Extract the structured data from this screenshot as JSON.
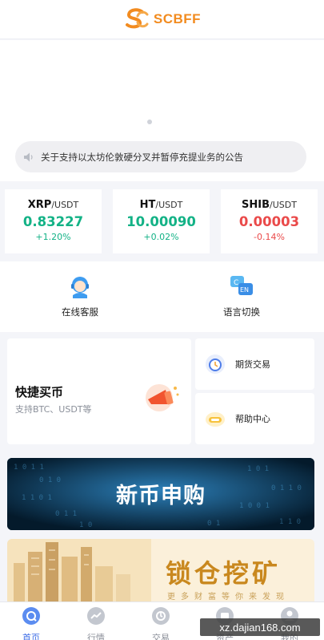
{
  "header": {
    "brand": "SCBFF",
    "brand_color": "#f28b1f"
  },
  "notice": {
    "icon": "speaker-icon",
    "text": "关于支持以太坊伦敦硬分叉并暂停充提业务的公告"
  },
  "tickers": [
    {
      "symbol": "XRP",
      "quote": "/USDT",
      "price": "0.83227",
      "change": "+1.20%",
      "direction": "up"
    },
    {
      "symbol": "HT",
      "quote": "/USDT",
      "price": "10.00090",
      "change": "+0.02%",
      "direction": "up"
    },
    {
      "symbol": "SHIB",
      "quote": "/USDT",
      "price": "0.00003",
      "change": "-0.14%",
      "direction": "down"
    }
  ],
  "services": [
    {
      "label": "在线客服",
      "icon": "customer-service-icon"
    },
    {
      "label": "语言切换",
      "icon": "language-switch-icon"
    }
  ],
  "quick_buy": {
    "title": "快捷买币",
    "subtitle": "支持BTC、USDT等",
    "icon": "megaphone-icon"
  },
  "side_cards": [
    {
      "label": "期货交易",
      "icon": "futures-icon"
    },
    {
      "label": "帮助中心",
      "icon": "help-icon"
    }
  ],
  "promos": [
    {
      "title": "新币申购"
    },
    {
      "title": "锁仓挖矿",
      "subtitle": "更多财富等你来发现"
    }
  ],
  "tabbar": [
    {
      "label": "首页",
      "icon": "home-icon",
      "active": true
    },
    {
      "label": "行情",
      "icon": "market-icon",
      "active": false
    },
    {
      "label": "交易",
      "icon": "trade-icon",
      "active": false
    },
    {
      "label": "资产",
      "icon": "assets-icon",
      "active": false
    },
    {
      "label": "我的",
      "icon": "profile-icon",
      "active": false
    }
  ],
  "watermark": "xz.dajian168.com",
  "colors": {
    "up": "#13b286",
    "down": "#ea4a4a",
    "accent": "#3c6ce6"
  }
}
